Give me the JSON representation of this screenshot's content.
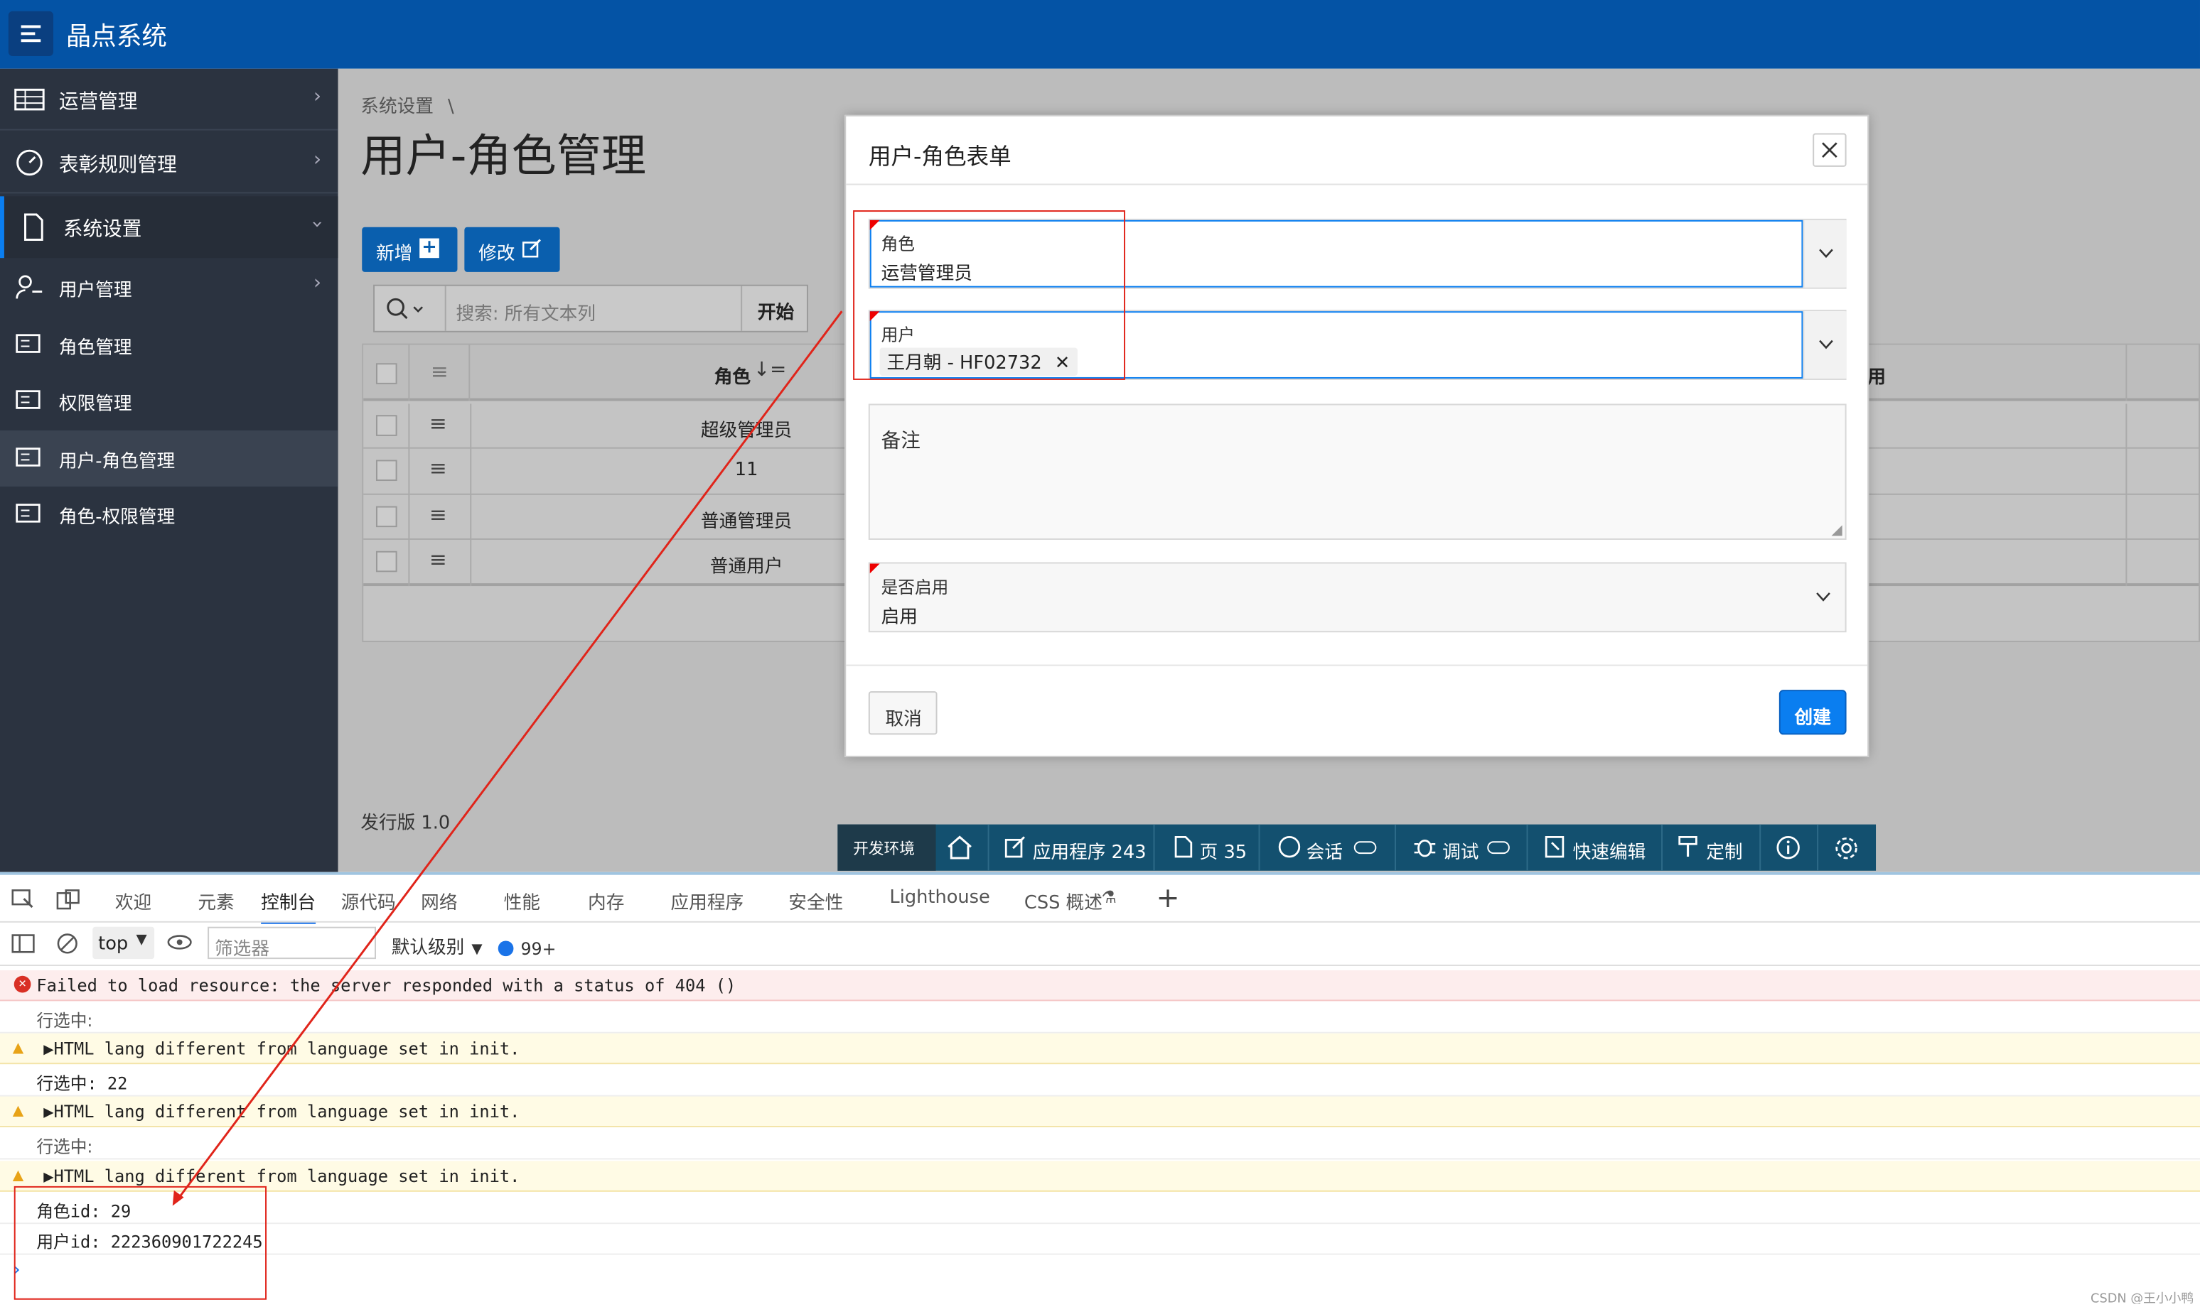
{
  "app": {
    "title": "晶点系统"
  },
  "sidebar": {
    "items": [
      {
        "label": "运营管理"
      },
      {
        "label": "表彰规则管理"
      },
      {
        "label": "系统设置"
      },
      {
        "label": "用户管理"
      },
      {
        "label": "角色管理"
      },
      {
        "label": "权限管理"
      },
      {
        "label": "用户-角色管理"
      },
      {
        "label": "角色-权限管理"
      }
    ]
  },
  "page": {
    "breadcrumb": "系统设置",
    "breadcrumb_sep": "\\",
    "title": "用户-角色管理",
    "version": "发行版 1.0"
  },
  "toolbar": {
    "add_label": "新增",
    "edit_label": "修改",
    "search_placeholder": "搜索: 所有文本列",
    "go_label": "开始"
  },
  "grid": {
    "col_role": "角色",
    "col_partial": "用",
    "rows": [
      "超级管理员",
      "11",
      "普通管理员",
      "普通用户"
    ]
  },
  "modal": {
    "title": "用户-角色表单",
    "role_label": "角色",
    "role_value": "运营管理员",
    "user_label": "用户",
    "user_chip": "王月朝 - HF02732",
    "remark_placeholder": "备注",
    "enabled_label": "是否启用",
    "enabled_value": "启用",
    "cancel_label": "取消",
    "create_label": "创建"
  },
  "devbar": {
    "env": "开发环境",
    "app": "应用程序 243",
    "page": "页 35",
    "session": "会话",
    "debug": "调试",
    "quickedit": "快速编辑",
    "customize": "定制"
  },
  "devtools": {
    "tabs": [
      "欢迎",
      "元素",
      "控制台",
      "源代码",
      "网络",
      "性能",
      "内存",
      "应用程序",
      "安全性",
      "Lighthouse",
      "CSS 概述"
    ],
    "context": "top",
    "filter_placeholder": "筛选器",
    "level": "默认级别",
    "badge": "99+",
    "logs": [
      {
        "type": "error",
        "text": "Failed to load resource: the server responded with a status of 404 ()"
      },
      {
        "type": "log",
        "text": "行选中:"
      },
      {
        "type": "warn",
        "text": "▶HTML lang different from language set in init."
      },
      {
        "type": "log",
        "text": "行选中: 22"
      },
      {
        "type": "warn",
        "text": "▶HTML lang different from language set in init."
      },
      {
        "type": "log",
        "text": "行选中:"
      },
      {
        "type": "warn",
        "text": "▶HTML lang different from language set in init."
      },
      {
        "type": "log",
        "text": "角色id: 29"
      },
      {
        "type": "log",
        "text": "用户id: 222360901722245"
      }
    ]
  },
  "watermark": "CSDN @王小小鸭",
  "colors": {
    "header": "#0453a5",
    "sidebar": "#2b3340",
    "primary": "#0a7ef0",
    "annotation": "#e0241a"
  }
}
